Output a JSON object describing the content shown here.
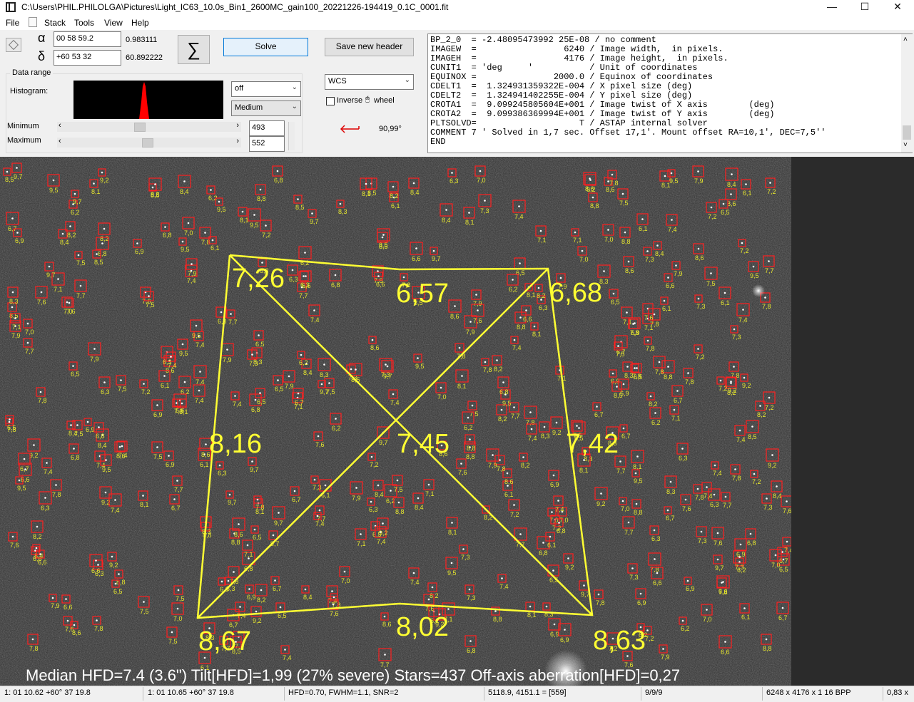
{
  "window": {
    "title": "C:\\Users\\PHIL.PHILOLGA\\Pictures\\Light_IC63_10.0s_Bin1_2600MC_gain100_20221226-194419_0.1C_0001.fit",
    "minimize": "—",
    "maximize": "☐",
    "close": "✕"
  },
  "menu": {
    "file": "File",
    "stack": "Stack",
    "tools": "Tools",
    "view": "View",
    "help": "Help"
  },
  "coords": {
    "alpha_symbol": "α",
    "ra_value": "00 58 59.2",
    "ra_decimal": "0.983111",
    "delta_symbol": "δ",
    "dec_value": "+60 53 32",
    "dec_decimal": "60.892222"
  },
  "buttons": {
    "sigma": "∑",
    "solve": "Solve",
    "save_header": "Save new header"
  },
  "data_range": {
    "title": "Data range",
    "histogram_label": "Histogram:",
    "stretch_mode": "off",
    "saturation": "Medium",
    "minimum_label": "Minimum",
    "maximum_label": "Maximum",
    "minimum_value": "493",
    "maximum_value": "552"
  },
  "wcs": {
    "mode": "WCS",
    "inverse_label": "Inverse",
    "wheel_label": "wheel",
    "angle": "90,99°"
  },
  "fits_header": "BP_2_0  = -2.48095473992 25E-08 / no comment\nIMAGEW  =                 6240 / Image width,  in pixels.\nIMAGEH  =                 4176 / Image height,  in pixels.\nCUNIT1  = 'deg     '           / Unit of coordinates\nEQUINOX =               2000.0 / Equinox of coordinates\nCDELT1  =  1.324931359322E-004 / X pixel size (deg)\nCDELT2  =  1.324941402255E-004 / Y pixel size (deg)\nCROTA1  =  9.099245805604E+001 / Image twist of X axis        (deg)\nCROTA2  =  9.099386369994E+001 / Image twist of Y axis        (deg)\nPLTSOLVD=                    T / ASTAP internal solver\nCOMMENT 7 ' Solved in 1,7 sec. Offset 17,1'. Mount offset RA=10,1', DEC=7,5''\nEND",
  "tilt": {
    "top_left": "7,26",
    "top_mid": "6,57",
    "top_right": "6,68",
    "mid_left": "8,16",
    "center": "7,45",
    "mid_right": "7,42",
    "bot_left": "8,67",
    "bot_mid": "8,02",
    "bot_right": "8,63",
    "summary": "Median HFD=7.4 (3.6\")  Tilt[HFD]=1,99 (27% severe)  Stars=437  Off-axis aberration[HFD]=0,27"
  },
  "star_labels": [
    "8,8",
    "7,6",
    "7,5",
    "6,3",
    "8,6",
    "7,4",
    "6,9",
    "6,5",
    "7,9",
    "7,8",
    "7,3",
    "8,3",
    "7,2",
    "6,2",
    "7,1",
    "6,7",
    "8,1",
    "7,7",
    "8,4",
    "9,2",
    "7,8",
    "8,5",
    "6,8",
    "9,7",
    "8,2",
    "7,0",
    "6,6",
    "9,5",
    "7,4",
    "6,1"
  ],
  "status": {
    "pos1": "1: 01  10.62   +60° 37  19.8",
    "pos2": "1: 01  10.65   +60° 37  19.8",
    "star_info": "HFD=0.70, FWHM=1.1, SNR=2",
    "pixel": "5118.9, 4151.1 = [559]",
    "misc": "9/9/9",
    "dims": "6248 x 4176 x 1   16 BPP",
    "zoom": "0,83 x"
  },
  "colors": {
    "tilt_lines": "#ffff33",
    "star_box": "#ff2020",
    "star_label": "#e6e62e",
    "histogram_peak": "#ff0000"
  }
}
